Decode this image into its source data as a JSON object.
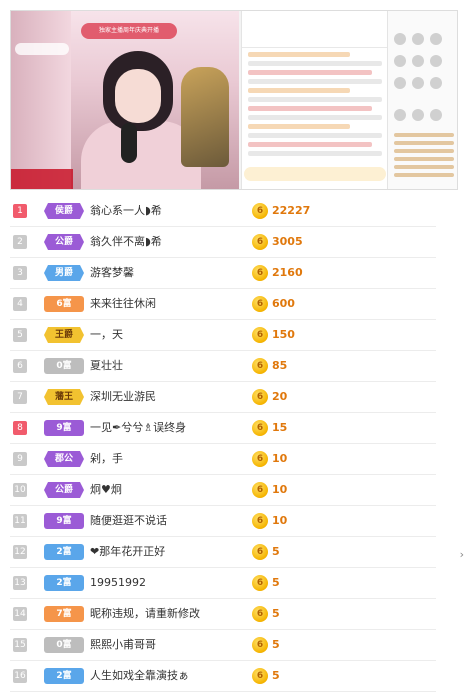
{
  "banner_text": "独家主播周年庆典开播",
  "rows": [
    {
      "rank": "1",
      "badge": "侯爵",
      "name": "翁心系一人◗希",
      "amount": "22227"
    },
    {
      "rank": "2",
      "badge": "公爵",
      "name": "翁久伴不离◗希",
      "amount": "3005"
    },
    {
      "rank": "3",
      "badge": "男爵",
      "name": "游客梦馨",
      "amount": "2160"
    },
    {
      "rank": "4",
      "badge": "6富",
      "name": "来来往往休闲",
      "amount": "600"
    },
    {
      "rank": "5",
      "badge": "王爵",
      "name": "一，天",
      "amount": "150"
    },
    {
      "rank": "6",
      "badge": "0富",
      "name": "夏壮壮",
      "amount": "85"
    },
    {
      "rank": "7",
      "badge": "藩王",
      "name": "深圳无业游民",
      "amount": "20"
    },
    {
      "rank": "8",
      "badge": "9富",
      "name": "一见✒兮兮♗误终身",
      "amount": "15"
    },
    {
      "rank": "9",
      "badge": "郡公",
      "name": "剁，手",
      "amount": "10"
    },
    {
      "rank": "10",
      "badge": "公爵",
      "name": "炯♥炯",
      "amount": "10"
    },
    {
      "rank": "11",
      "badge": "9富",
      "name": "随便逛逛不说话",
      "amount": "10"
    },
    {
      "rank": "12",
      "badge": "2富",
      "name": "❤那年花开正好",
      "amount": "5"
    },
    {
      "rank": "13",
      "badge": "2富",
      "name": "19951992",
      "amount": "5"
    },
    {
      "rank": "14",
      "badge": "7富",
      "name": "昵称违规，请重新修改",
      "amount": "5"
    },
    {
      "rank": "15",
      "badge": "0富",
      "name": "熙熙小甫哥哥",
      "amount": "5"
    },
    {
      "rank": "16",
      "badge": "2富",
      "name": "人生如戏全靠演技ぁ",
      "amount": "5"
    }
  ],
  "coin_symbol": "6",
  "scroll_arrow": "›"
}
